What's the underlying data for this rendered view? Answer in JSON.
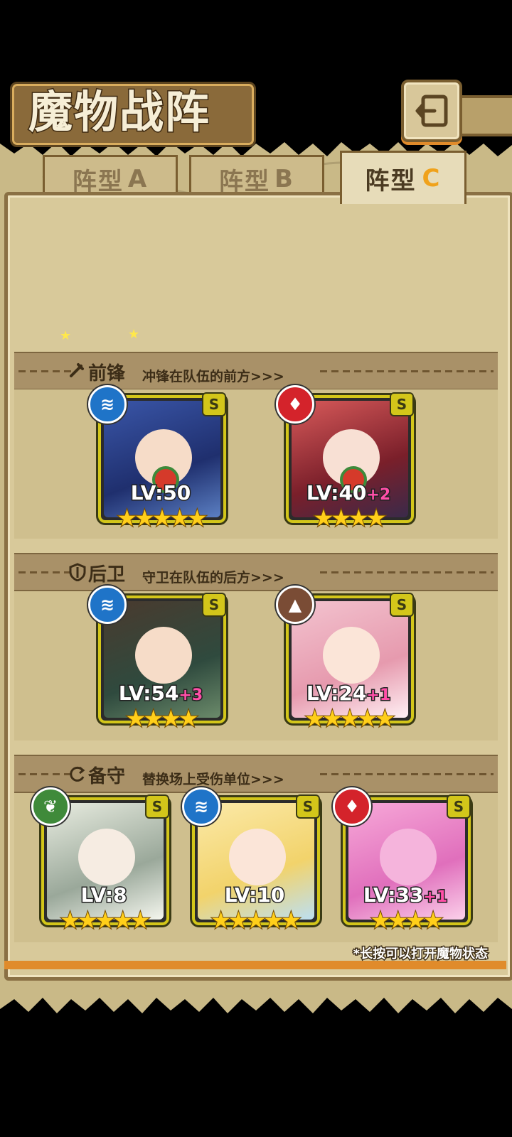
{
  "title": "魔物战阵",
  "tabs": [
    {
      "label": "阵型",
      "suffix": "A",
      "active": false
    },
    {
      "label": "阵型",
      "suffix": "B",
      "active": false
    },
    {
      "label": "阵型",
      "suffix": "C",
      "active": true
    }
  ],
  "sections": [
    {
      "title": "前锋",
      "icon": "sword-icon",
      "description": "冲锋在队伍的前方>>>",
      "cards": [
        {
          "element": "water",
          "rank": "S",
          "level": "LV:50",
          "bonus": "",
          "stars": 5
        },
        {
          "element": "fire",
          "rank": "S",
          "level": "LV:40",
          "bonus": "+2",
          "stars": 4
        }
      ]
    },
    {
      "title": "后卫",
      "icon": "shield-icon",
      "description": "守卫在队伍的后方>>>",
      "cards": [
        {
          "element": "water",
          "rank": "S",
          "level": "LV:54",
          "bonus": "+3",
          "stars": 4
        },
        {
          "element": "earth",
          "rank": "S",
          "level": "LV:24",
          "bonus": "+1",
          "stars": 5
        }
      ]
    },
    {
      "title": "备守",
      "icon": "swap-icon",
      "description": "替换场上受伤单位>>>",
      "cards": [
        {
          "element": "wind",
          "rank": "S",
          "level": "LV:8",
          "bonus": "",
          "stars": 5
        },
        {
          "element": "water",
          "rank": "S",
          "level": "LV:10",
          "bonus": "",
          "stars": 5
        },
        {
          "element": "fire",
          "rank": "S",
          "level": "LV:33",
          "bonus": "+1",
          "stars": 4
        }
      ]
    }
  ],
  "hint": "*长按可以打开魔物状态",
  "colors": {
    "water": "#1f74c8",
    "fire": "#d4232b",
    "earth": "#7a4c35",
    "wind": "#3f8a3a",
    "frame": "#d3c61a",
    "plus": "#ff4fa8",
    "accent": "#f0a21b"
  }
}
